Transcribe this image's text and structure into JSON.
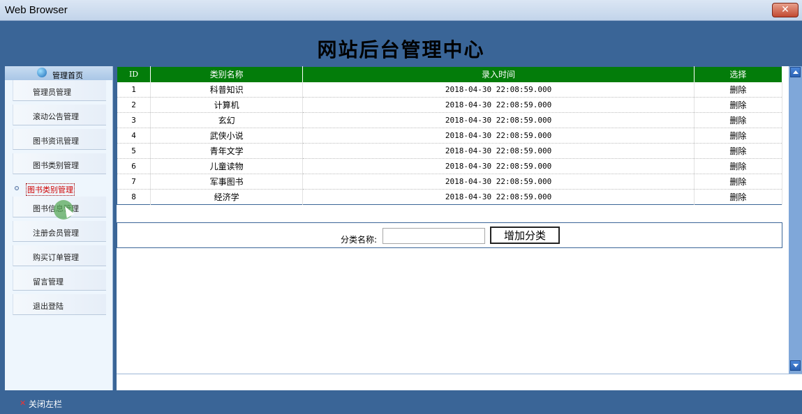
{
  "window": {
    "title": "Web Browser",
    "close_glyph": "✕"
  },
  "banner": {
    "title": "网站后台管理中心"
  },
  "sidebar": {
    "home_label": "管理首页",
    "items": [
      {
        "label": "管理员管理"
      },
      {
        "label": "滚动公告管理"
      },
      {
        "label": "图书资讯管理"
      },
      {
        "label": "图书类别管理"
      },
      {
        "label": "图书信息管理"
      },
      {
        "label": "注册会员管理"
      },
      {
        "label": "购买订单管理"
      },
      {
        "label": "留言管理"
      },
      {
        "label": "退出登陆"
      }
    ],
    "active_label": "图书类别管理"
  },
  "table": {
    "headers": {
      "id": "ID",
      "name": "类别名称",
      "time": "录入时间",
      "op": "选择"
    },
    "rows": [
      {
        "id": "1",
        "name": "科普知识",
        "time": "2018-04-30 22:08:59.000",
        "op": "删除"
      },
      {
        "id": "2",
        "name": "计算机",
        "time": "2018-04-30 22:08:59.000",
        "op": "删除"
      },
      {
        "id": "3",
        "name": "玄幻",
        "time": "2018-04-30 22:08:59.000",
        "op": "删除"
      },
      {
        "id": "4",
        "name": "武侠小说",
        "time": "2018-04-30 22:08:59.000",
        "op": "删除"
      },
      {
        "id": "5",
        "name": "青年文学",
        "time": "2018-04-30 22:08:59.000",
        "op": "删除"
      },
      {
        "id": "6",
        "name": "儿童读物",
        "time": "2018-04-30 22:08:59.000",
        "op": "删除"
      },
      {
        "id": "7",
        "name": "军事图书",
        "time": "2018-04-30 22:08:59.000",
        "op": "删除"
      },
      {
        "id": "8",
        "name": "经济学",
        "time": "2018-04-30 22:08:59.000",
        "op": "删除"
      }
    ]
  },
  "form": {
    "label": "分类名称:",
    "value": "",
    "button": "增加分类"
  },
  "footer": {
    "close_glyph": "✕",
    "label": "关闭左栏"
  },
  "colors": {
    "header_green": "#037c0a",
    "frame_blue": "#3a6597",
    "active_red": "#d00000"
  }
}
